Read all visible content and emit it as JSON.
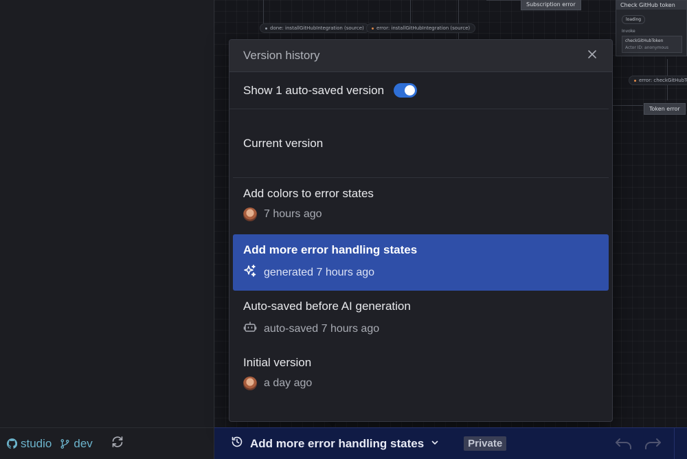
{
  "sidebar": {
    "footer": {
      "studio_label": "studio",
      "branch_label": "dev"
    }
  },
  "canvas": {
    "chips": [
      {
        "label": "done: installGitHubIntegration (source)"
      },
      {
        "label": "error: installGitHubIntegration (source)"
      },
      {
        "label": "error: checkGitHubToken"
      }
    ],
    "nodes": {
      "subscription_error": "Subscription error",
      "token_error": "Token error"
    },
    "state_card": {
      "title": "Check GitHub token",
      "tag": "loading",
      "invoke_label": "Invoke",
      "invoke_name": "checkGitHubToken",
      "actor_id_label": "Actor ID:",
      "actor_id_value": "anonymous"
    }
  },
  "modal": {
    "title": "Version history",
    "toggle": {
      "label": "Show 1 auto-saved version",
      "on": true
    },
    "current_version_label": "Current version",
    "versions": [
      {
        "title": "Add colors to error states",
        "meta": "7 hours ago",
        "icon": "avatar",
        "selected": false
      },
      {
        "title": "Add more error handling states",
        "meta": "generated 7 hours ago",
        "icon": "sparkles-icon",
        "selected": true
      },
      {
        "title": "Auto-saved before AI generation",
        "meta": "auto-saved 7 hours ago",
        "icon": "robot-icon",
        "selected": false
      },
      {
        "title": "Initial version",
        "meta": "a day ago",
        "icon": "avatar",
        "selected": false
      }
    ]
  },
  "bottombar": {
    "title": "Add more error handling states",
    "visibility_badge": "Private"
  },
  "colors": {
    "accent": "#2f6fd6",
    "selected_row": "#2f4fa8",
    "bottombar": "#101b45",
    "link": "#6cb4cc"
  }
}
